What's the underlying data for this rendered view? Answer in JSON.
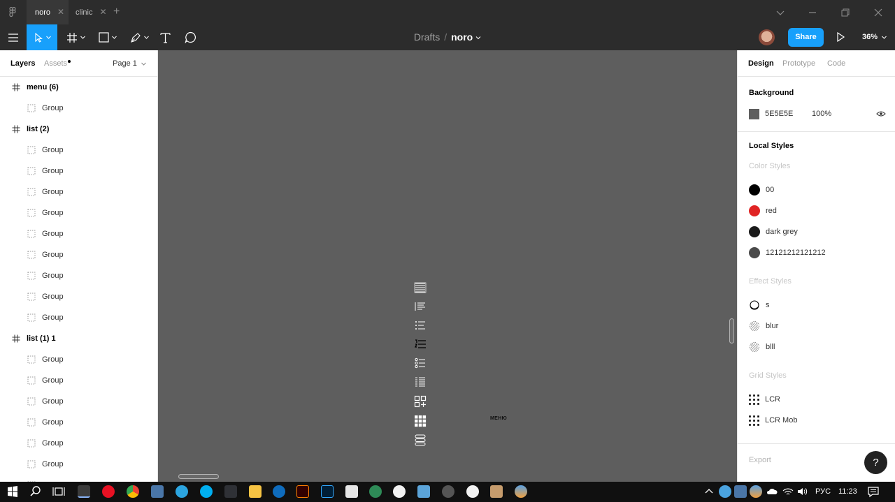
{
  "titlebar": {
    "tabs": [
      {
        "label": "noro",
        "active": true
      },
      {
        "label": "clinic",
        "active": false
      }
    ]
  },
  "toolbar": {
    "breadcrumb_parent": "Drafts",
    "breadcrumb_sep": "/",
    "file_name": "noro",
    "share_label": "Share",
    "zoom": "36%"
  },
  "left_panel": {
    "tab_layers": "Layers",
    "tab_assets": "Assets",
    "page": "Page 1",
    "layers": [
      {
        "type": "frame",
        "label": "menu (6)"
      },
      {
        "type": "group",
        "label": "Group"
      },
      {
        "type": "frame",
        "label": "list (2)"
      },
      {
        "type": "group",
        "label": "Group"
      },
      {
        "type": "group",
        "label": "Group"
      },
      {
        "type": "group",
        "label": "Group"
      },
      {
        "type": "group",
        "label": "Group"
      },
      {
        "type": "group",
        "label": "Group"
      },
      {
        "type": "group",
        "label": "Group"
      },
      {
        "type": "group",
        "label": "Group"
      },
      {
        "type": "group",
        "label": "Group"
      },
      {
        "type": "group",
        "label": "Group"
      },
      {
        "type": "frame",
        "label": "list (1) 1"
      },
      {
        "type": "group",
        "label": "Group"
      },
      {
        "type": "group",
        "label": "Group"
      },
      {
        "type": "group",
        "label": "Group"
      },
      {
        "type": "group",
        "label": "Group"
      },
      {
        "type": "group",
        "label": "Group"
      },
      {
        "type": "group",
        "label": "Group"
      },
      {
        "type": "group",
        "label": "Group"
      }
    ]
  },
  "canvas": {
    "background": "#5e5e5e",
    "frame_label": "МЕНЮ"
  },
  "right_panel": {
    "tab_design": "Design",
    "tab_prototype": "Prototype",
    "tab_code": "Code",
    "background_title": "Background",
    "background_hex": "5E5E5E",
    "background_opacity": "100%",
    "local_styles_title": "Local Styles",
    "color_styles_title": "Color Styles",
    "color_styles": [
      {
        "name": "00",
        "color": "#000000"
      },
      {
        "name": "red",
        "color": "#e02424"
      },
      {
        "name": "dark grey",
        "color": "#1a1a1a"
      },
      {
        "name": "12121212121212",
        "color": "#4a4a4a"
      }
    ],
    "effect_styles_title": "Effect Styles",
    "effect_styles": [
      {
        "name": "s",
        "icon": "drop-shadow-icon"
      },
      {
        "name": "blur",
        "icon": "blur-icon"
      },
      {
        "name": "blll",
        "icon": "blur-icon"
      }
    ],
    "grid_styles_title": "Grid Styles",
    "grid_styles": [
      {
        "name": "LCR",
        "icon": "grid-icon"
      },
      {
        "name": "LCR Mob",
        "icon": "grid-icon"
      }
    ],
    "export_title": "Export",
    "help_label": "?"
  },
  "taskbar": {
    "language": "РУС",
    "time": "11:23"
  }
}
